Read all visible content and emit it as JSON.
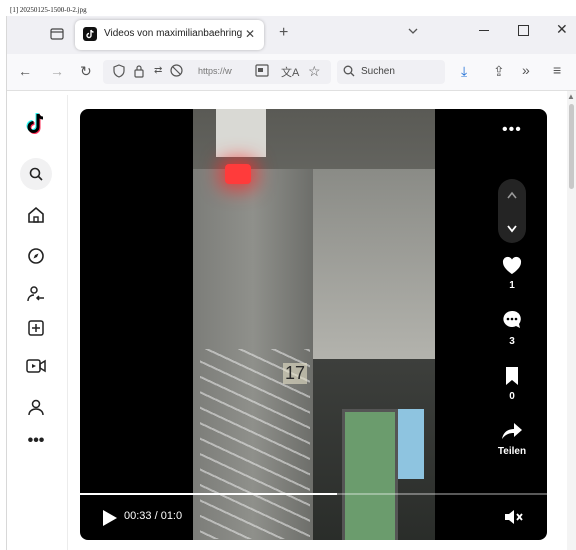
{
  "file_caption": "[1] 20250125-1500-0-2.jpg",
  "browser": {
    "tab_title": "Videos von maximilianbaehring",
    "url": "https://ww",
    "search_placeholder": "Suchen"
  },
  "sidebar": {
    "items": [
      "home",
      "explore",
      "following",
      "upload",
      "live",
      "profile",
      "more"
    ]
  },
  "video": {
    "time": "00:33 / 01:0",
    "progress": 0.55,
    "sign_number": "17",
    "actions": {
      "likes": "1",
      "comments": "3",
      "saves": "0",
      "share_label": "Teilen"
    }
  },
  "colors": {
    "tabstrip": "#f0f0f4",
    "navbar": "#f9f9fb",
    "video_bg": "#000000",
    "text_light": "#ffffff"
  }
}
